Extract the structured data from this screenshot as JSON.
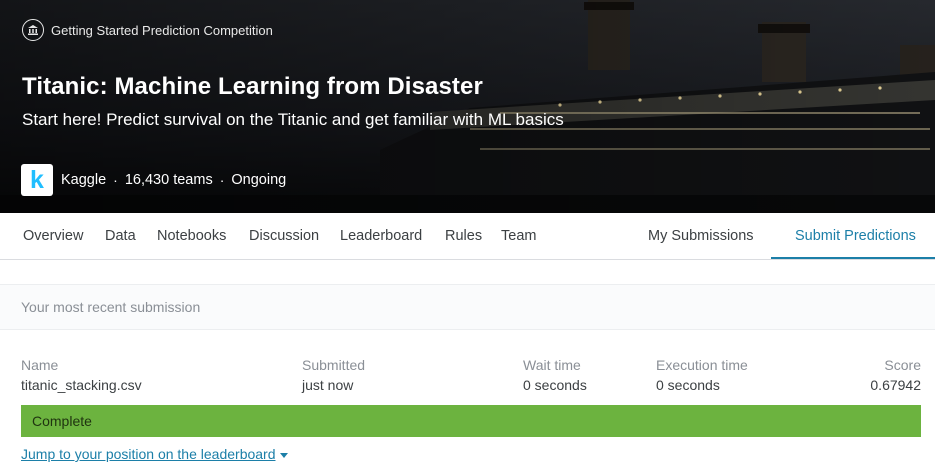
{
  "header": {
    "competition_type": "Getting Started Prediction Competition",
    "title": "Titanic: Machine Learning from Disaster",
    "subtitle": "Start here! Predict survival on the Titanic and get familiar with ML basics",
    "host": "Kaggle",
    "host_logo_letter": "k",
    "teams": "16,430 teams",
    "status": "Ongoing",
    "separator": "·",
    "icon": "bank-icon"
  },
  "nav": {
    "tabs": [
      "Overview",
      "Data",
      "Notebooks",
      "Discussion",
      "Leaderboard",
      "Rules",
      "Team"
    ],
    "my_submissions": "My Submissions",
    "submit_predictions": "Submit Predictions",
    "active_color": "#1c7fa8"
  },
  "submission": {
    "section_label": "Your most recent submission",
    "columns": {
      "name": "Name",
      "submitted": "Submitted",
      "wait_time": "Wait time",
      "execution_time": "Execution time",
      "score": "Score"
    },
    "row": {
      "name": "titanic_stacking.csv",
      "submitted": "just now",
      "wait_time": "0 seconds",
      "execution_time": "0 seconds",
      "score": "0.67942"
    },
    "status": "Complete",
    "status_color": "#6cb33f",
    "jump_link": "Jump to your position on the leaderboard"
  }
}
